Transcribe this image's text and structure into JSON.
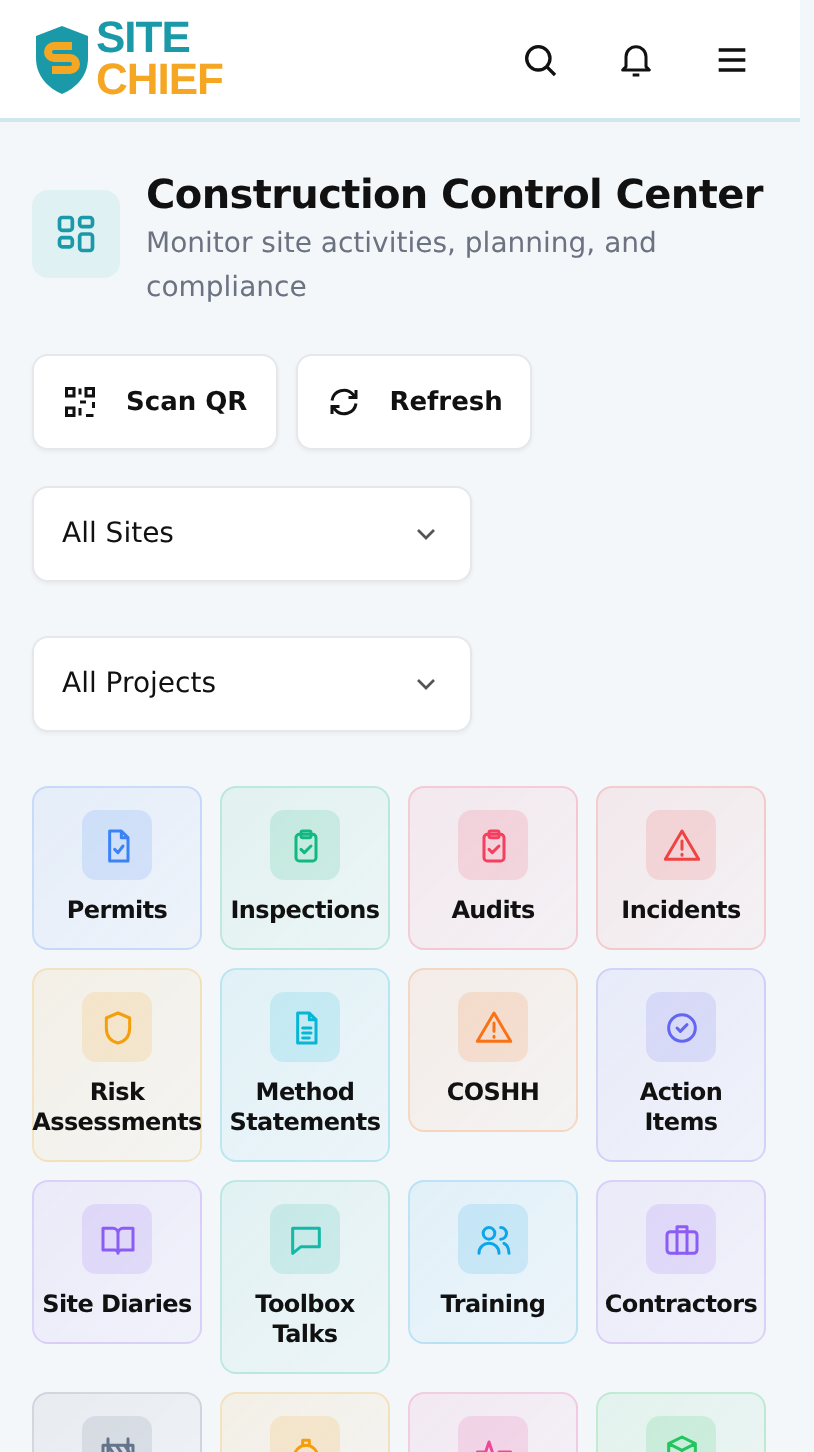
{
  "header": {
    "logo_top": "SITE",
    "logo_bottom": "CHIEF"
  },
  "page": {
    "title": "Construction Control Center",
    "subtitle": "Monitor site activities, planning, and compliance"
  },
  "actions": [
    {
      "label": "Scan QR"
    },
    {
      "label": "Refresh"
    }
  ],
  "filters": [
    {
      "value": "All Sites"
    },
    {
      "value": "All Projects"
    }
  ],
  "modules": [
    {
      "label": "Permits",
      "color": "#3b82f6"
    },
    {
      "label": "Inspections",
      "color": "#10b981"
    },
    {
      "label": "Audits",
      "color": "#f43f5e"
    },
    {
      "label": "Incidents",
      "color": "#ef4444"
    },
    {
      "label": "Risk Assessments",
      "color": "#f59e0b"
    },
    {
      "label": "Method Statements",
      "color": "#06b6d4"
    },
    {
      "label": "COSHH",
      "color": "#f97316"
    },
    {
      "label": "Action Items",
      "color": "#6366f1"
    },
    {
      "label": "Site Diaries",
      "color": "#8b5cf6"
    },
    {
      "label": "Toolbox Talks",
      "color": "#14b8a6"
    },
    {
      "label": "Training",
      "color": "#0ea5e9"
    },
    {
      "label": "Contractors",
      "color": "#8b5cf6"
    },
    {
      "color": "#64748b"
    },
    {
      "color": "#f59e0b"
    },
    {
      "color": "#ec4899"
    },
    {
      "color": "#22c55e"
    }
  ]
}
